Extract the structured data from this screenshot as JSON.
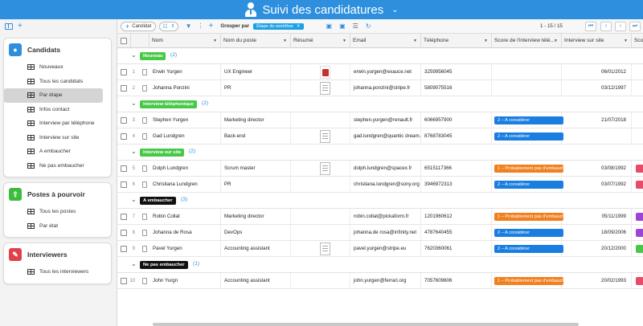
{
  "app": {
    "title": "Suivi des candidatures"
  },
  "sidebar": {
    "panels": [
      {
        "title": "Candidats",
        "icon": "user-icon",
        "color": "#2d8fdd",
        "items": [
          "Nouveaux",
          "Tous les candidats",
          "Par étape",
          "Infos contact",
          "Interview par téléphone",
          "Interview sur site",
          "A embaucher",
          "Ne pas embaucher"
        ],
        "active": "Par étape"
      },
      {
        "title": "Postes à pourvoir",
        "icon": "arrow-up-icon",
        "color": "#3dbb3d",
        "items": [
          "Tous les postes",
          "Par état"
        ]
      },
      {
        "title": "Interviewers",
        "icon": "chat-icon",
        "color": "#e0404a",
        "items": [
          "Tous les interviewers"
        ]
      }
    ]
  },
  "toolbar": {
    "add_label": "Candidat",
    "group_label": "Grouper par",
    "group_chip": "Étape du workflow",
    "pager": "1 - 15 / 15"
  },
  "columns": [
    "Nom",
    "Nom du poste",
    "Résumé",
    "Email",
    "Téléphone",
    "Score de l'interview télé...",
    "Interview sur site",
    "Sco"
  ],
  "groups": [
    {
      "label": "Nouveau",
      "count": "(2)",
      "color": "#48c848",
      "rows": [
        {
          "n": "1",
          "name": "Erwin Yurgen",
          "job": "UX Engineer",
          "resume": "pdf",
          "email": "erwin.yurgen@exauce.net",
          "phone": "3259956045",
          "score": "",
          "date": "06/01/2012",
          "edge": ""
        },
        {
          "n": "2",
          "name": "Johanna Ponzini",
          "job": "PR",
          "resume": "doc",
          "email": "johanna.ponzini@stripe.fr",
          "phone": "5809075516",
          "score": "",
          "date": "03/12/1997",
          "edge": ""
        }
      ]
    },
    {
      "label": "Interview téléphonique",
      "count": "(2)",
      "color": "#48c848",
      "rows": [
        {
          "n": "3",
          "name": "Stephen Yurgen",
          "job": "Marketing director",
          "resume": "",
          "email": "stephen.yurgen@renault.fr",
          "phone": "6066957900",
          "score": "2 – A considérer",
          "scoreColor": "#1a7ee0",
          "date": "21/07/2018",
          "edge": ""
        },
        {
          "n": "4",
          "name": "Gad Lundgren",
          "job": "Back-end",
          "resume": "doc",
          "email": "gad.lundgren@quantic dream...",
          "phone": "8768783045",
          "score": "2 – A considérer",
          "scoreColor": "#1a7ee0",
          "date": "",
          "edge": ""
        }
      ]
    },
    {
      "label": "Interview sur site",
      "count": "(2)",
      "color": "#48c848",
      "rows": [
        {
          "n": "5",
          "name": "Dolph Lundgren",
          "job": "Scrum master",
          "resume": "doc",
          "email": "dolph.lundgren@spacex.fr",
          "phone": "6515117366",
          "score": "1 – Probablement pas d'embauche",
          "scoreColor": "#f08020",
          "date": "03/08/1992",
          "edge": "#e84a6a"
        },
        {
          "n": "6",
          "name": "Christiana Lundgren",
          "job": "PR",
          "resume": "",
          "email": "christiana.lundgren@sony.org",
          "phone": "3946972313",
          "score": "2 – A considérer",
          "scoreColor": "#1a7ee0",
          "date": "03/07/1992",
          "edge": "#e84a6a"
        }
      ]
    },
    {
      "label": "A embaucher",
      "count": "(3)",
      "color": "#111111",
      "rows": [
        {
          "n": "7",
          "name": "Robin Collat",
          "job": "Marketing director",
          "resume": "",
          "email": "robin.collat@pickaform.fr",
          "phone": "1201960612",
          "score": "1 – Probablement pas d'embauche",
          "scoreColor": "#f08020",
          "date": "05/11/1999",
          "edge": "#9a44d8"
        },
        {
          "n": "8",
          "name": "Johanna de Rosa",
          "job": "DevOps",
          "resume": "",
          "email": "johanna.de rosa@infinity.net",
          "phone": "4787640455",
          "score": "2 – A considérer",
          "scoreColor": "#1a7ee0",
          "date": "18/09/2006",
          "edge": "#9a44d8"
        },
        {
          "n": "9",
          "name": "Pavel Yurgen",
          "job": "Accounting assistant",
          "resume": "doc",
          "email": "pavel.yurgen@stripe.eu",
          "phone": "7620360061",
          "score": "2 – A considérer",
          "scoreColor": "#1a7ee0",
          "date": "20/12/2000",
          "edge": "#48c848"
        }
      ]
    },
    {
      "label": "Ne pas embaucher",
      "count": "(1)",
      "color": "#111111",
      "rows": [
        {
          "n": "10",
          "name": "John Yurgn",
          "job": "Accounting assistant",
          "resume": "",
          "email": "john.yurgen@ferrari.org",
          "phone": "7057609606",
          "score": "1 – Probablement pas d'embauche",
          "scoreColor": "#f08020",
          "date": "20/02/1993",
          "edge": "#e84a6a"
        }
      ]
    }
  ]
}
